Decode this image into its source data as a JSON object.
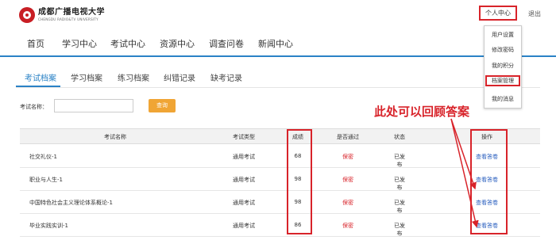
{
  "header": {
    "logo_cn": "成都广播电视大学",
    "logo_en": "CHENGDU RADIO&TV UNIVERSITY",
    "user_center": "个人中心",
    "logout": "退出"
  },
  "nav": {
    "items": [
      "首页",
      "学习中心",
      "考试中心",
      "资源中心",
      "调查问卷",
      "新闻中心"
    ]
  },
  "dropdown": {
    "items": [
      "用户设置",
      "修改密码",
      "我的积分",
      "档案管理",
      "我的消息"
    ],
    "highlighted": "档案管理"
  },
  "subtabs": {
    "items": [
      "考试档案",
      "学习档案",
      "练习档案",
      "纠错记录",
      "缺考记录"
    ],
    "active": "考试档案"
  },
  "search": {
    "label": "考试名称：",
    "value": "",
    "button": "查询"
  },
  "table": {
    "headers": [
      "考试名称",
      "考试类型",
      "成绩",
      "是否通过",
      "状态",
      "操作"
    ],
    "rows": [
      {
        "name": "社交礼仪-1",
        "type": "通用考试",
        "score": "68",
        "passed": "保密",
        "status": "已发布",
        "action": "查看答卷"
      },
      {
        "name": "职业与人生-1",
        "type": "通用考试",
        "score": "98",
        "passed": "保密",
        "status": "已发布",
        "action": "查看答卷"
      },
      {
        "name": "中国特色社会主义理论体系概论-1",
        "type": "通用考试",
        "score": "98",
        "passed": "保密",
        "status": "已发布",
        "action": "查看答卷"
      },
      {
        "name": "毕业实践实训-1",
        "type": "通用考试",
        "score": "86",
        "passed": "保密",
        "status": "已发布",
        "action": "查看答卷"
      }
    ]
  },
  "annotation": {
    "text": "此处可以回顾答案",
    "color": "#d8232a"
  },
  "colors": {
    "accent": "#2a82c6",
    "highlight": "#d8232a",
    "query_button": "#f0a535",
    "link": "#2a5fbf"
  }
}
